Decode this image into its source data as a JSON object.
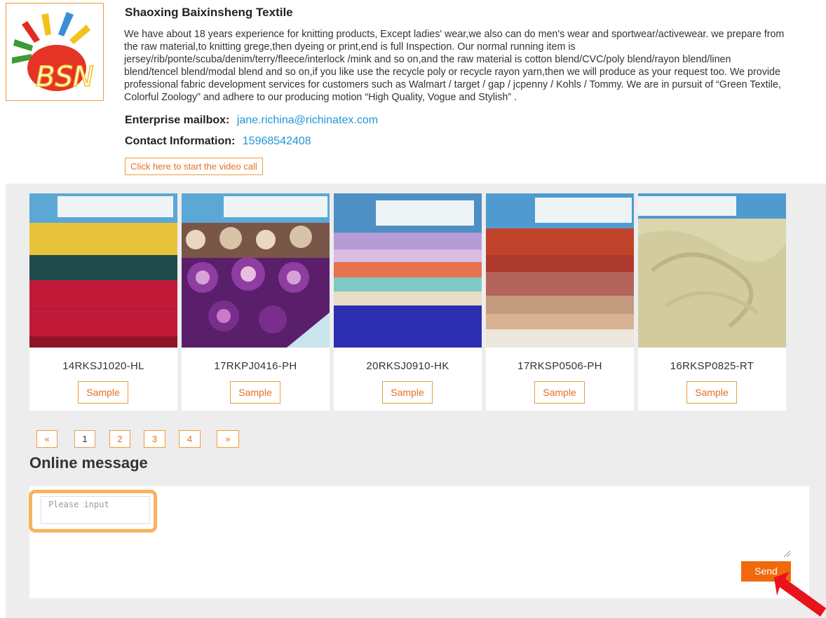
{
  "company": {
    "name": "Shaoxing Baixinsheng Textile",
    "logo_text": "BSN",
    "description": "We have about 18 years experience for knitting products, Except ladies' wear,we also can do men's wear and sportwear/activewear. we prepare from the raw material,to knitting grege,then dyeing or print,end is full Inspection. Our normal running item is jersey/rib/ponte/scuba/denim/terry/fleece/interlock /mink and so on,and the raw material is cotton blend/CVC/poly blend/rayon blend/linen blend/tencel blend/modal blend and so on,if you like use the recycle poly or recycle rayon yarn,then we will produce as your request too. We provide professional fabric development services for customers such as Walmart / target / gap / jcpenny / Kohls / Tommy. We are in pursuit of  “Green Textile, Colorful Zoology”   and adhere to our producing motion  “High Quality, Vogue and Stylish” .",
    "mailbox_label": "Enterprise mailbox:",
    "mailbox_value": "jane.richina@richinatex.com",
    "contact_label": "Contact Information:",
    "contact_value": "15968542408",
    "video_call_label": "Click here to start the video call"
  },
  "products": [
    {
      "code": "14RKSJ1020-HL",
      "sample_label": "Sample",
      "image_icon": "fabric-swatch-image"
    },
    {
      "code": "17RKPJ0416-PH",
      "sample_label": "Sample",
      "image_icon": "fabric-swatch-image"
    },
    {
      "code": "20RKSJ0910-HK",
      "sample_label": "Sample",
      "image_icon": "fabric-swatch-image"
    },
    {
      "code": "17RKSP0506-PH",
      "sample_label": "Sample",
      "image_icon": "fabric-swatch-image"
    },
    {
      "code": "16RKSP0825-RT",
      "sample_label": "Sample",
      "image_icon": "fabric-swatch-image"
    }
  ],
  "pagination": {
    "prev": "«",
    "pages": [
      "1",
      "2",
      "3",
      "4"
    ],
    "next": "»",
    "current": "1"
  },
  "message": {
    "title": "Online message",
    "placeholder": "Please input",
    "send_label": "Send"
  },
  "colors": {
    "accent": "#f29b3a",
    "button_text": "#e4701e",
    "link": "#2196d4",
    "send_bg": "#f06a0b",
    "panel_bg": "#ededed",
    "highlight": "#f9b35a",
    "annotation_arrow": "#e8141b"
  }
}
